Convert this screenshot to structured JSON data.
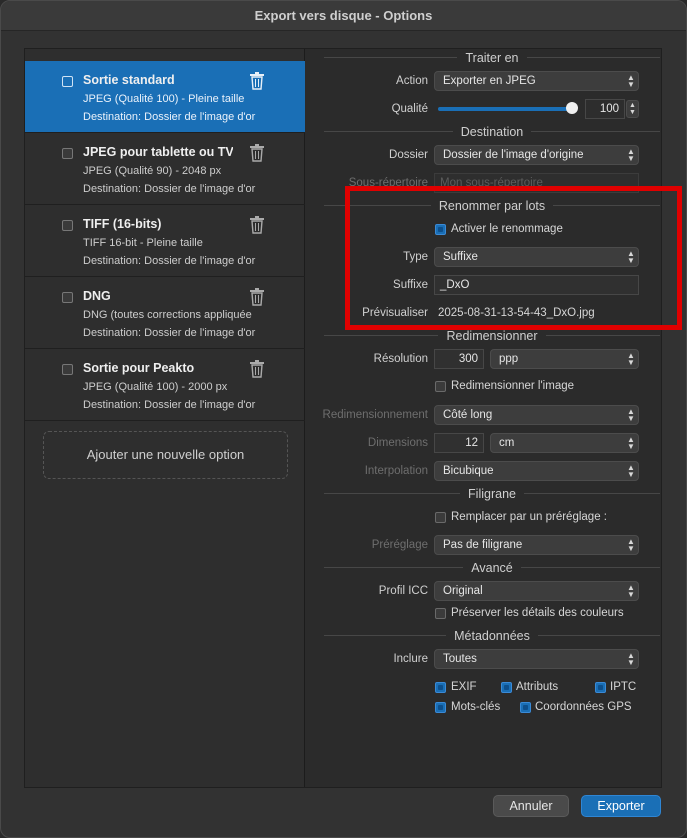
{
  "window": {
    "title": "Export vers disque - Options"
  },
  "presets": [
    {
      "name": "Sortie standard",
      "line1": "JPEG (Qualité 100) - Pleine taille",
      "line2": "Destination: Dossier de l'image d'or"
    },
    {
      "name": "JPEG pour tablette ou TV",
      "line1": "JPEG (Qualité 90) - 2048 px",
      "line2": "Destination: Dossier de l'image d'or"
    },
    {
      "name": "TIFF (16-bits)",
      "line1": "TIFF 16-bit - Pleine taille",
      "line2": "Destination: Dossier de l'image d'or"
    },
    {
      "name": "DNG",
      "line1": "DNG (toutes corrections appliquée",
      "line2": "Destination: Dossier de l'image d'or"
    },
    {
      "name": "Sortie pour Peakto",
      "line1": "JPEG (Qualité 100) - 2000 px",
      "line2": "Destination: Dossier de l'image d'or"
    }
  ],
  "add_option": "Ajouter une nouvelle option",
  "sections": {
    "traiter": "Traiter en",
    "destination": "Destination",
    "renommer": "Renommer par lots",
    "redim": "Redimensionner",
    "filigrane": "Filigrane",
    "avance": "Avancé",
    "meta": "Métadonnées"
  },
  "traiter": {
    "action_label": "Action",
    "action_value": "Exporter en JPEG",
    "qualite_label": "Qualité",
    "qualite_value": "100",
    "qualite_fraction": 1.0
  },
  "destination": {
    "dossier_label": "Dossier",
    "dossier_value": "Dossier de l'image d'origine",
    "sous_label": "Sous-répertoire",
    "sous_placeholder": "Mon sous-répertoire"
  },
  "renommer": {
    "activer": "Activer le renommage",
    "type_label": "Type",
    "type_value": "Suffixe",
    "suffixe_label": "Suffixe",
    "suffixe_value": "_DxO",
    "preview_label": "Prévisualiser",
    "preview_value": "2025-08-31-13-54-43_DxO.jpg"
  },
  "redim": {
    "resolution_label": "Résolution",
    "resolution_value": "300",
    "resolution_unit": "ppp",
    "redim_check": "Redimensionner l'image",
    "redimensionnement_label": "Redimensionnement",
    "redimensionnement_value": "Côté long",
    "dimensions_label": "Dimensions",
    "dimensions_value": "12",
    "dimensions_unit": "cm",
    "interpolation_label": "Interpolation",
    "interpolation_value": "Bicubique"
  },
  "filigrane": {
    "remplacer": "Remplacer par un préréglage :",
    "prereglage_label": "Préréglage",
    "prereglage_value": "Pas de filigrane"
  },
  "avance": {
    "profil_label": "Profil ICC",
    "profil_value": "Original",
    "preserver": "Préserver les détails des couleurs"
  },
  "meta": {
    "inclure_label": "Inclure",
    "inclure_value": "Toutes",
    "exif": "EXIF",
    "attributs": "Attributs",
    "iptc": "IPTC",
    "motscles": "Mots-clés",
    "gps": "Coordonnées GPS"
  },
  "buttons": {
    "cancel": "Annuler",
    "export": "Exporter"
  },
  "colors": {
    "accent": "#1a6fb6",
    "highlight": "#e00000"
  }
}
